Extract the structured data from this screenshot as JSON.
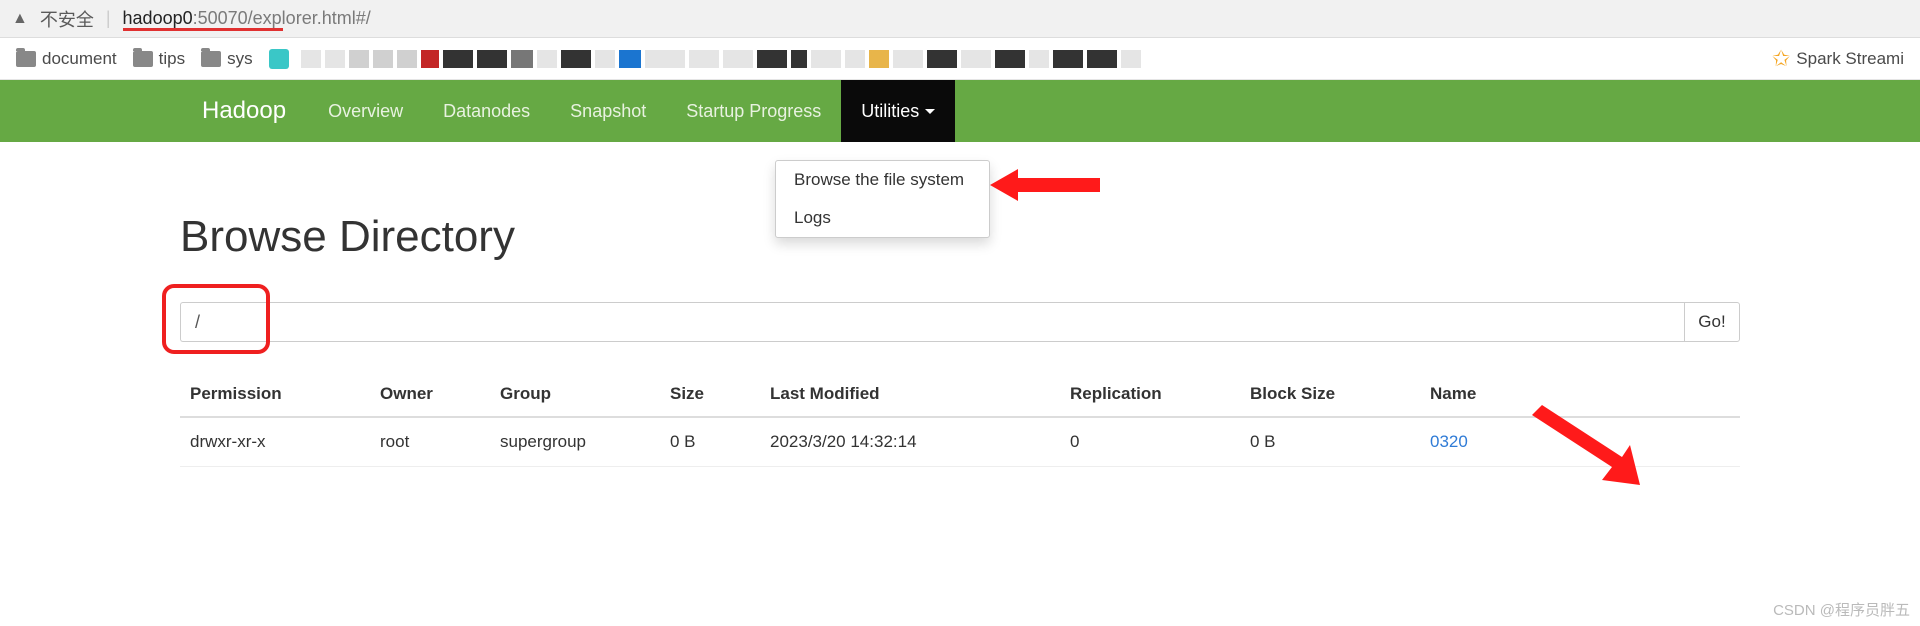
{
  "browser": {
    "warn_label": "不安全",
    "url_host": "hadoop0",
    "url_port_path": ":50070/explorer.html#/"
  },
  "bookmarks": {
    "items": [
      "document",
      "tips",
      "sys"
    ],
    "right_label": "Spark Streami"
  },
  "nav": {
    "brand": "Hadoop",
    "links": [
      "Overview",
      "Datanodes",
      "Snapshot",
      "Startup Progress"
    ],
    "utilities": "Utilities"
  },
  "dropdown": {
    "items": [
      "Browse the file system",
      "Logs"
    ]
  },
  "page": {
    "title": "Browse Directory",
    "path_value": "/",
    "go_label": "Go!"
  },
  "table": {
    "headers": {
      "permission": "Permission",
      "owner": "Owner",
      "group": "Group",
      "size": "Size",
      "last_modified": "Last Modified",
      "replication": "Replication",
      "block_size": "Block Size",
      "name": "Name"
    },
    "rows": [
      {
        "permission": "drwxr-xr-x",
        "owner": "root",
        "group": "supergroup",
        "size": "0 B",
        "last_modified": "2023/3/20 14:32:14",
        "replication": "0",
        "block_size": "0 B",
        "name": "0320"
      }
    ]
  },
  "watermark": "CSDN @程序员胖五"
}
